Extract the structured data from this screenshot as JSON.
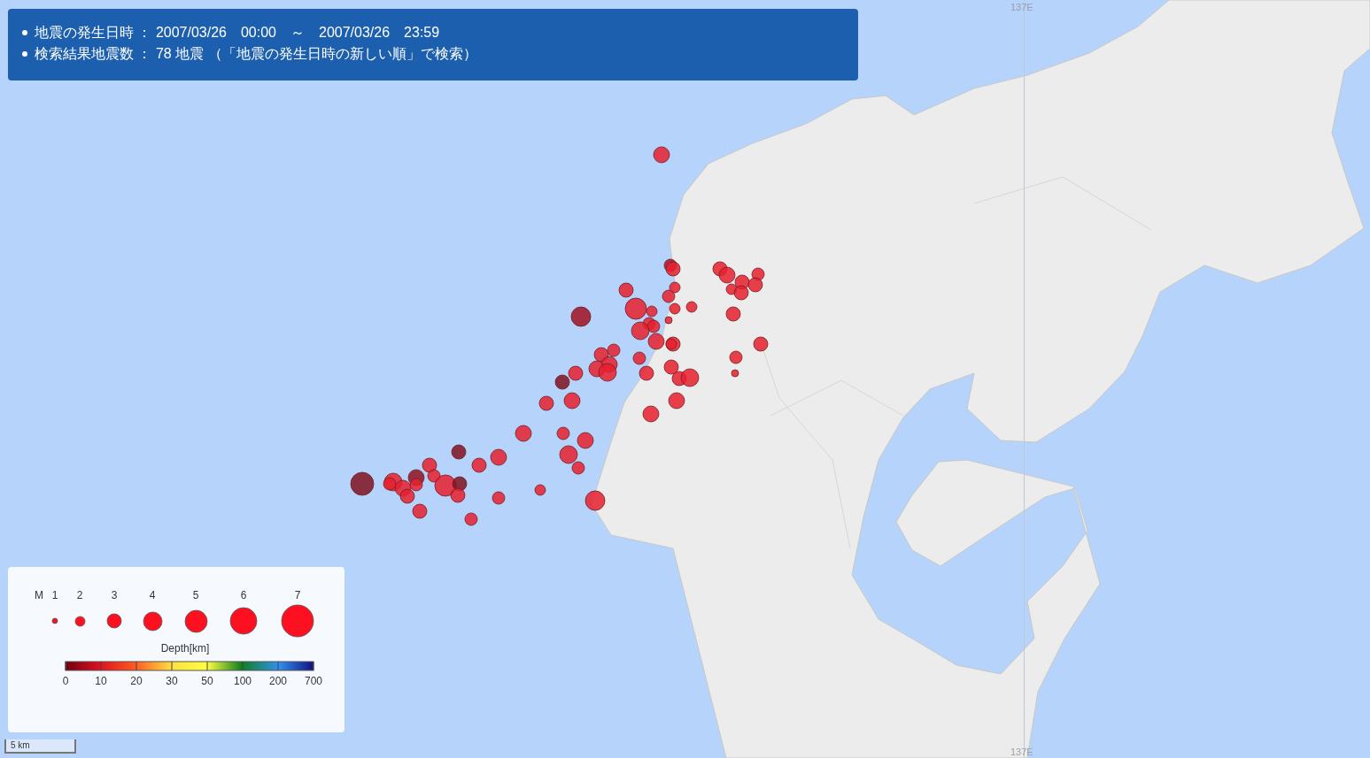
{
  "search_summary": [
    "地震の発生日時 ： 2007/03/26　00:00　～　2007/03/26　23:59",
    "検索結果地震数 ： 78 地震 （「地震の発生日時の新しい順」で検索）"
  ],
  "grid_labels": {
    "top": "137E",
    "bottom": "137E"
  },
  "legend": {
    "magnitude_label": "M",
    "magnitudes": [
      "1",
      "2",
      "3",
      "4",
      "5",
      "6",
      "7"
    ],
    "depth_title": "Depth[km]",
    "depth_ticks": [
      "0",
      "10",
      "20",
      "30",
      "50",
      "100",
      "200",
      "700"
    ]
  },
  "scale_bar": "5 km"
}
